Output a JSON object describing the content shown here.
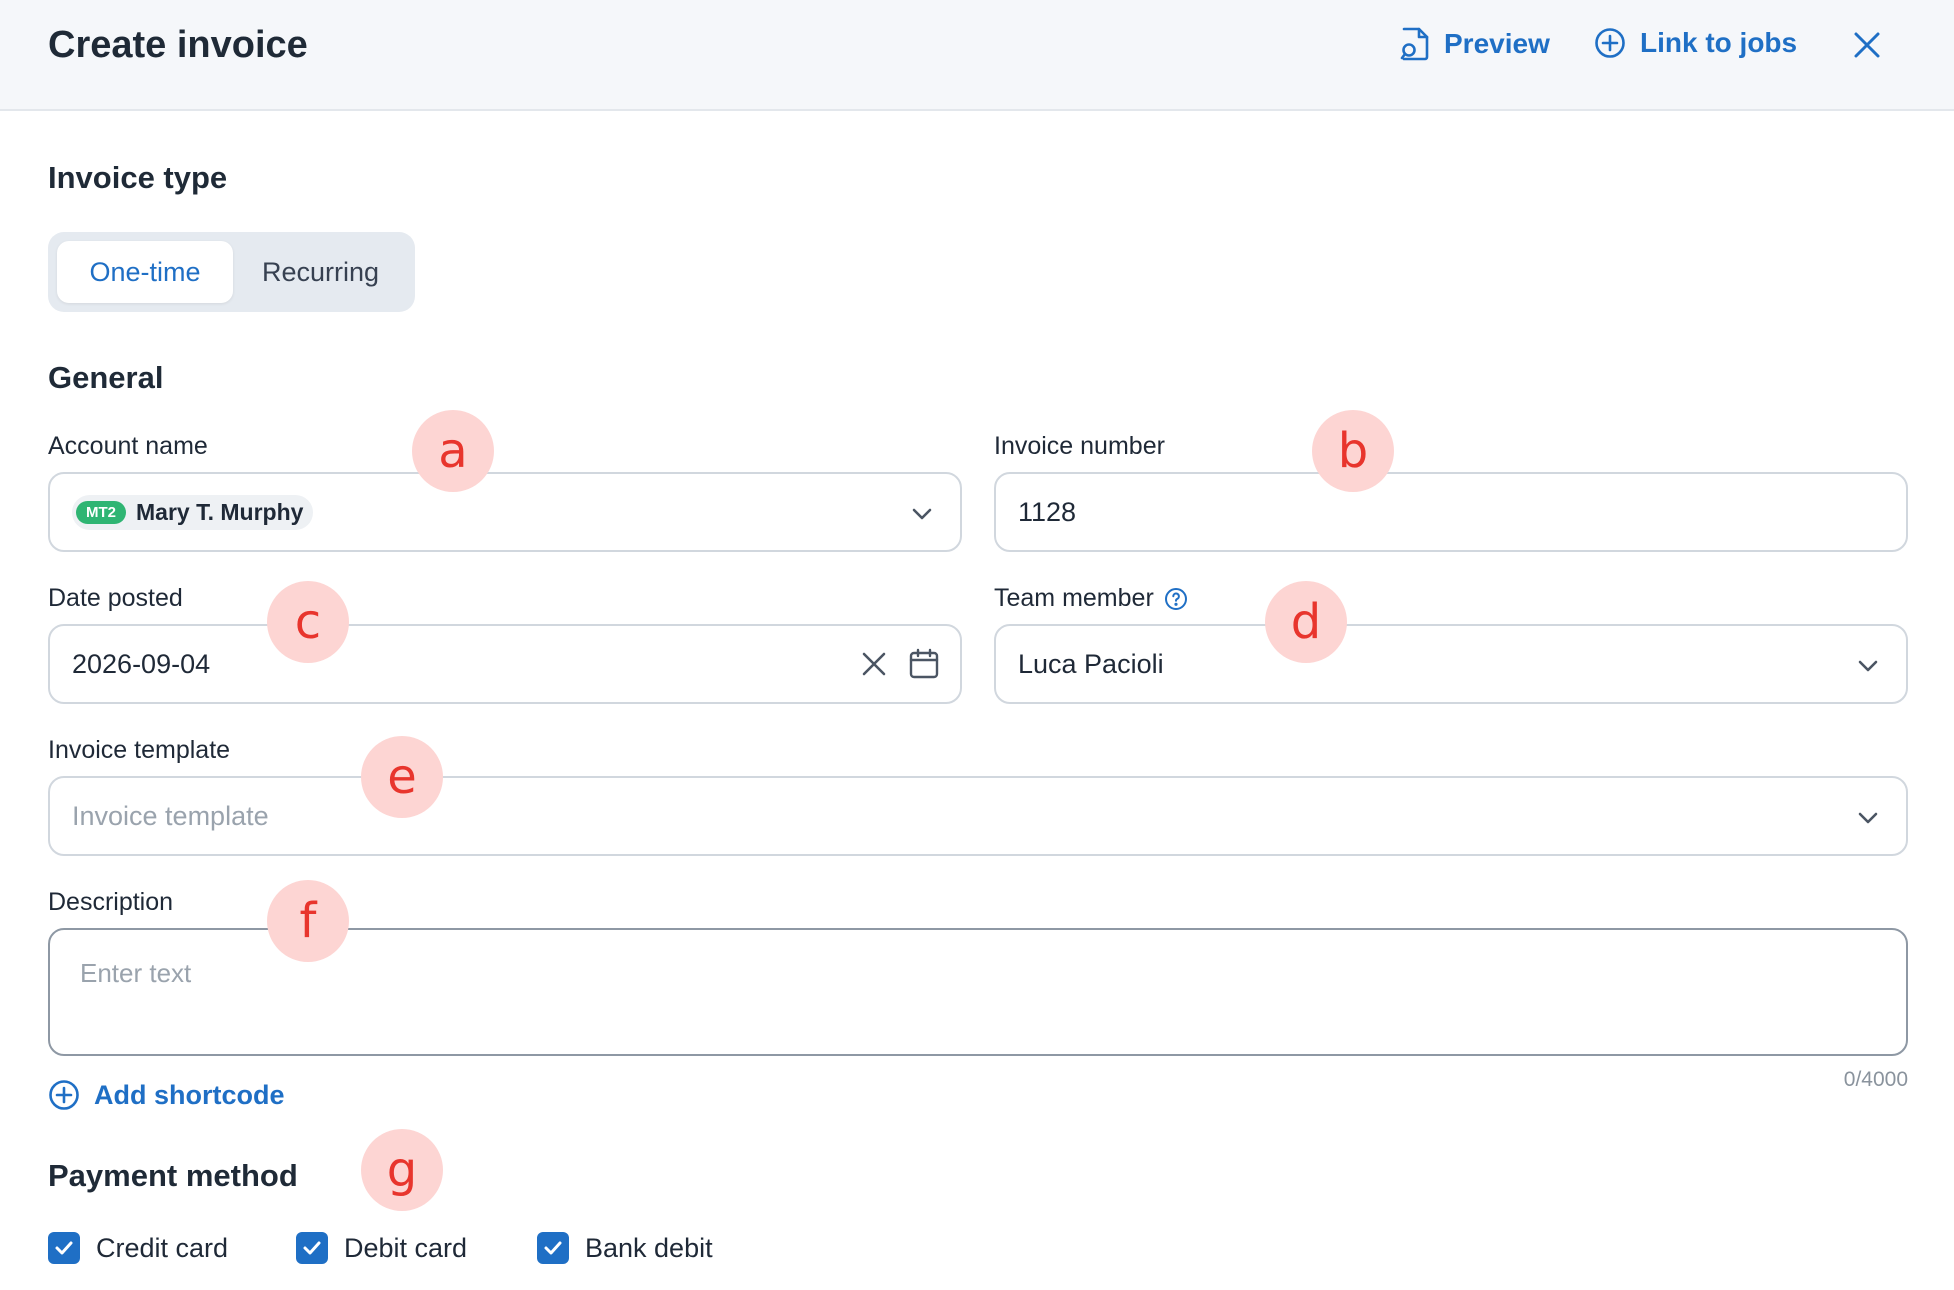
{
  "header": {
    "title": "Create invoice",
    "preview_label": "Preview",
    "link_jobs_label": "Link to jobs"
  },
  "invoice_type": {
    "heading": "Invoice type",
    "options": [
      "One-time",
      "Recurring"
    ],
    "selected": "One-time"
  },
  "general": {
    "heading": "General",
    "account_name": {
      "label": "Account name",
      "badge": "MT2",
      "value": "Mary T. Murphy"
    },
    "invoice_number": {
      "label": "Invoice number",
      "value": "1128"
    },
    "date_posted": {
      "label": "Date posted",
      "value": "2026-09-04"
    },
    "team_member": {
      "label": "Team member",
      "value": "Luca Pacioli"
    },
    "invoice_template": {
      "label": "Invoice template",
      "placeholder": "Invoice template"
    },
    "description": {
      "label": "Description",
      "placeholder": "Enter text",
      "counter": "0/4000"
    },
    "add_shortcode_label": "Add shortcode"
  },
  "payment_method": {
    "heading": "Payment method",
    "options": [
      {
        "label": "Credit card",
        "checked": true
      },
      {
        "label": "Debit card",
        "checked": true
      },
      {
        "label": "Bank debit",
        "checked": true
      }
    ]
  },
  "markers": [
    "a",
    "b",
    "c",
    "d",
    "e",
    "f",
    "g"
  ],
  "colors": {
    "accent": "#1f6fc5",
    "badge": "#2fb573",
    "marker_bg": "#fdd5d3",
    "marker_text": "#e8352d"
  }
}
